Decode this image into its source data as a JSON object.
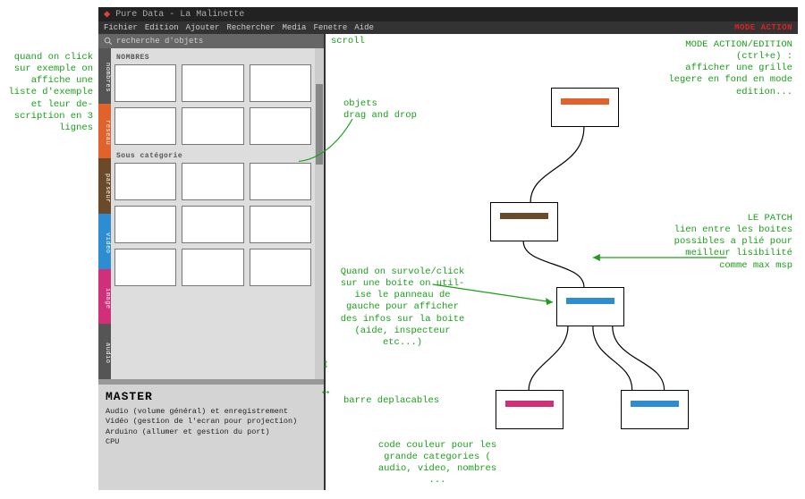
{
  "title": "Pure Data - La Malinette",
  "menu": [
    "Fichier",
    "Edition",
    "Ajouter",
    "Rechercher",
    "Media",
    "Fenetre",
    "Aide"
  ],
  "mode_badge": "MODE ACTION",
  "search_placeholder": "recherche d'objets",
  "categories": {
    "cat1": "NOMBRES",
    "cat2": "Sous catégorie"
  },
  "side_tabs": [
    {
      "label": "nombres",
      "color": "#555"
    },
    {
      "label": "reseau",
      "color": "#e0632e"
    },
    {
      "label": "parseur",
      "color": "#6b4a2a"
    },
    {
      "label": "video",
      "color": "#2e8cd0"
    },
    {
      "label": "image",
      "color": "#d0307a"
    },
    {
      "label": "audio",
      "color": "#555"
    }
  ],
  "master": {
    "title": "MASTER",
    "lines": [
      "Audio (volume général) et enregistrement",
      "Vidéo (gestion de l'ecran pour projection)",
      "Arduino (allumer et gestion du port)",
      "CPU"
    ]
  },
  "patch_boxes": [
    {
      "id": "n0",
      "stripe": "#e0632e"
    },
    {
      "id": "n1",
      "stripe": "#6b4a2a"
    },
    {
      "id": "n2",
      "stripe": "#2e8cd0"
    },
    {
      "id": "n3",
      "stripe": "#d0307a"
    },
    {
      "id": "n4",
      "stripe": "#2e8cd0"
    }
  ],
  "annotations": {
    "left1": "quand on click\nsur exemple on\naffiche une\nliste d'exemple\net leur de-\nscription en 3\nlignes",
    "scroll": "scroll",
    "dragdrop": "objets\ndrag and drop",
    "mode": "MODE ACTION/EDITION\n(ctrl+e) :\nafficher une grille\nlegere en fond en mode\nedition...",
    "patch": "LE PATCH\nlien entre les boites\npossibles a plié pour\nmeilleur lisibilité\ncomme max msp",
    "hover": "Quand on survole/click\nsur une boite on util-\nise le panneau de\ngauche pour afficher\ndes infos sur la boite\n(aide, inspecteur\netc...)",
    "bar": "barre deplacables",
    "colors": "code couleur pour les\ngrande categories (\naudio, video, nombres\n..."
  }
}
